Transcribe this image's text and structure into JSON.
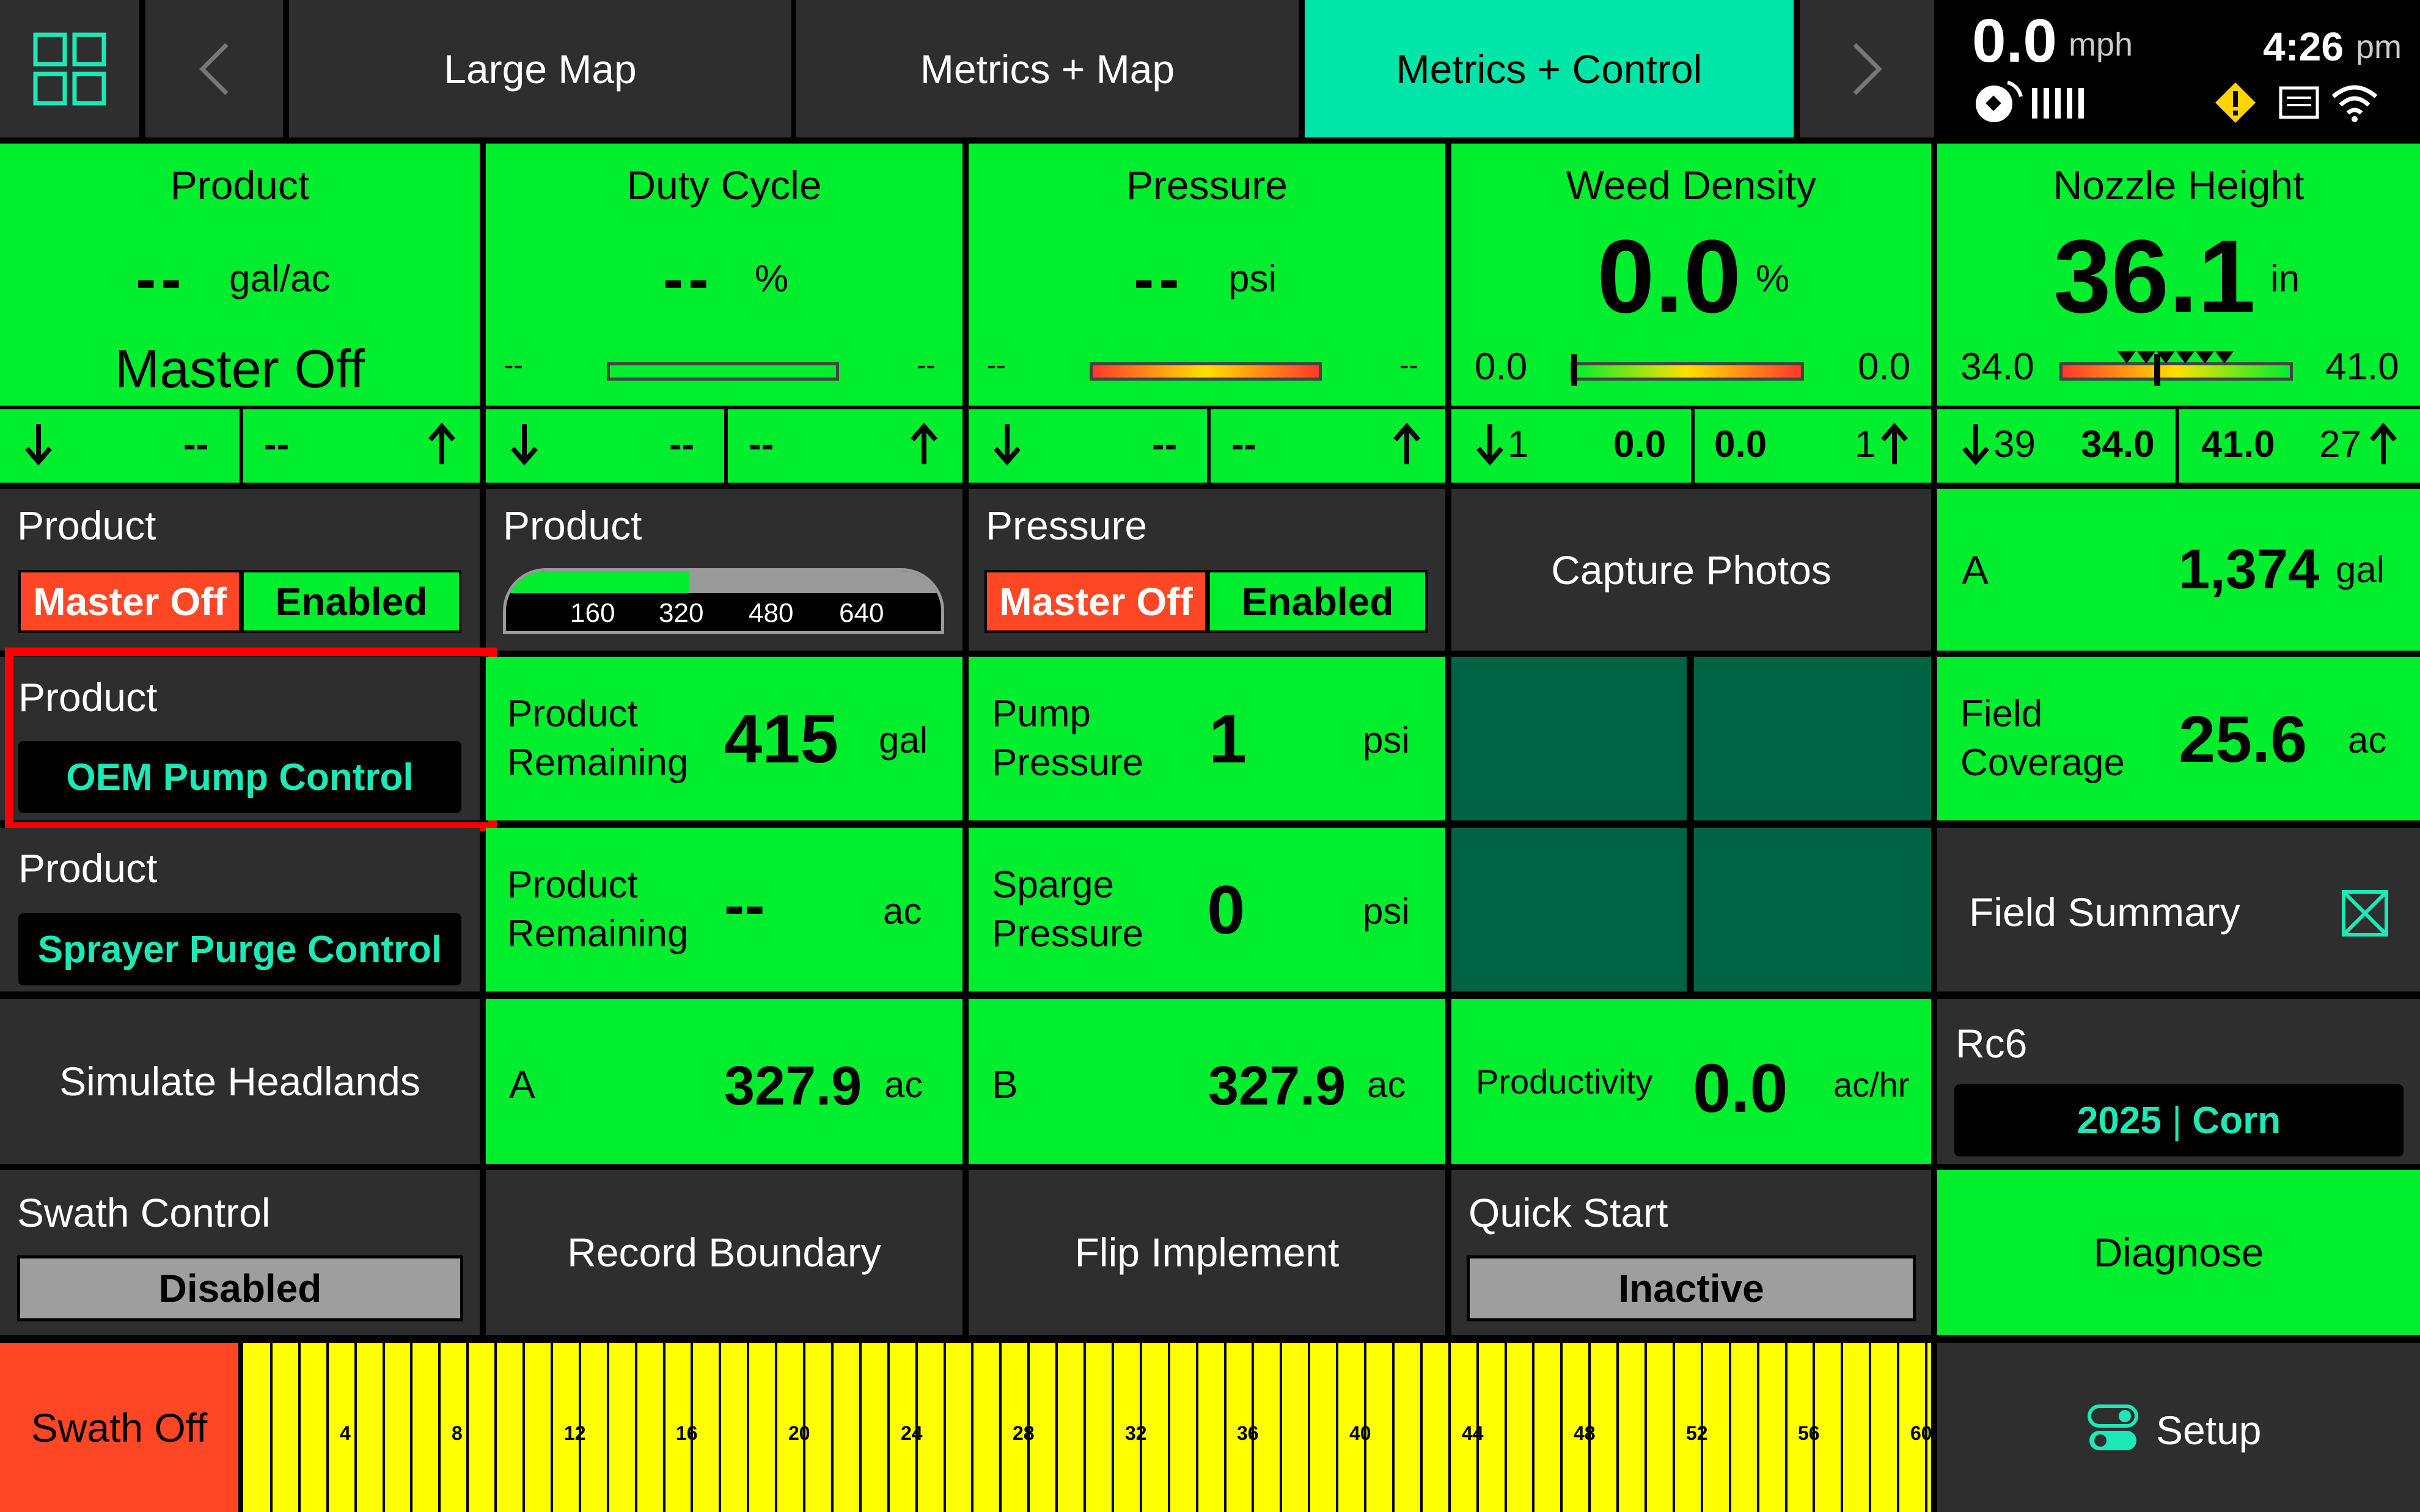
{
  "nav": {
    "tabs": [
      "Large Map",
      "Metrics + Map",
      "Metrics + Control"
    ],
    "active_tab": "Metrics + Control"
  },
  "status": {
    "speed": "0.0",
    "speed_unit": "mph",
    "time": "4:26",
    "ampm": "pm"
  },
  "metrics": {
    "product": {
      "title": "Product",
      "value": "--",
      "unit": "gal/ac",
      "state": "Master Off",
      "down": "--",
      "up": "--"
    },
    "duty": {
      "title": "Duty Cycle",
      "value": "--",
      "unit": "%",
      "min": "--",
      "max": "--",
      "down": "--",
      "up": "--"
    },
    "pressure": {
      "title": "Pressure",
      "value": "--",
      "unit": "psi",
      "min": "--",
      "max": "--",
      "down": "--",
      "up": "--"
    },
    "weed": {
      "title": "Weed Density",
      "value": "0.0",
      "unit": "%",
      "min": "0.0",
      "max": "0.0",
      "down_count": "1",
      "down": "0.0",
      "up": "0.0",
      "up_count": "1",
      "level": 0.0
    },
    "nozzle": {
      "title": "Nozzle Height",
      "value": "36.1",
      "unit": "in",
      "min": "34.0",
      "max": "41.0",
      "down_count": "39",
      "down": "34.0",
      "up": "41.0",
      "up_count": "27",
      "level": 0.3
    }
  },
  "controls": {
    "product_master": {
      "title": "Product",
      "off": "Master Off",
      "on": "Enabled"
    },
    "product_gauge": {
      "title": "Product",
      "ticks": [
        "160",
        "320",
        "480",
        "640"
      ],
      "fill": 0.42
    },
    "pressure_master": {
      "title": "Pressure",
      "off": "Master Off",
      "on": "Enabled"
    },
    "capture_photos": "Capture Photos",
    "tank_a": {
      "label": "A",
      "value": "1,374",
      "unit": "gal"
    },
    "oem_pump": {
      "title": "Product",
      "button": "OEM Pump Control"
    },
    "product_remaining_gal": {
      "label1": "Product",
      "label2": "Remaining",
      "value": "415",
      "unit": "gal"
    },
    "pump_pressure": {
      "label1": "Pump",
      "label2": "Pressure",
      "value": "1",
      "unit": "psi"
    },
    "field_coverage": {
      "label1": "Field",
      "label2": "Coverage",
      "value": "25.6",
      "unit": "ac"
    },
    "sprayer_purge": {
      "title": "Product",
      "button": "Sprayer Purge Control"
    },
    "product_remaining_ac": {
      "label1": "Product",
      "label2": "Remaining",
      "value": "--",
      "unit": "ac"
    },
    "sparge_pressure": {
      "label1": "Sparge",
      "label2": "Pressure",
      "value": "0",
      "unit": "psi"
    },
    "field_summary": "Field Summary",
    "simulate_headlands": "Simulate Headlands",
    "area_a": {
      "label": "A",
      "value": "327.9",
      "unit": "ac"
    },
    "area_b": {
      "label": "B",
      "value": "327.9",
      "unit": "ac"
    },
    "productivity": {
      "label": "Productivity",
      "value": "0.0",
      "unit": "ac/hr"
    },
    "rc6": {
      "title": "Rc6",
      "year": "2025",
      "sep": "|",
      "crop": "Corn"
    },
    "swath_control": {
      "title": "Swath Control",
      "state": "Disabled"
    },
    "record_boundary": "Record Boundary",
    "flip_implement": "Flip Implement",
    "quick_start": {
      "title": "Quick Start",
      "state": "Inactive"
    },
    "diagnose": "Diagnose"
  },
  "bottom": {
    "swath_off": "Swath Off",
    "ruler_labels": [
      "4",
      "8",
      "12",
      "16",
      "20",
      "24",
      "28",
      "32",
      "36",
      "40",
      "44",
      "48",
      "52",
      "56",
      "60"
    ],
    "setup": "Setup"
  },
  "icons": {
    "apps": "apps-grid-icon",
    "prev": "chevron-left-icon",
    "next": "chevron-right-icon",
    "gps": "gps-satellite-icon",
    "signal": "signal-bars-icon",
    "warning": "warning-icon",
    "display": "display-icon",
    "wifi": "wifi-icon",
    "field_summary": "field-summary-icon",
    "setup": "toggle-settings-icon"
  },
  "colors": {
    "green": "#00ee2e",
    "teal_tab": "#00e6a8",
    "red": "#ff4726",
    "dark_tile": "#2e2e2e",
    "dark_green": "#006444",
    "ruler_yellow": "#ffff00",
    "teal_text": "#1de9b6"
  }
}
